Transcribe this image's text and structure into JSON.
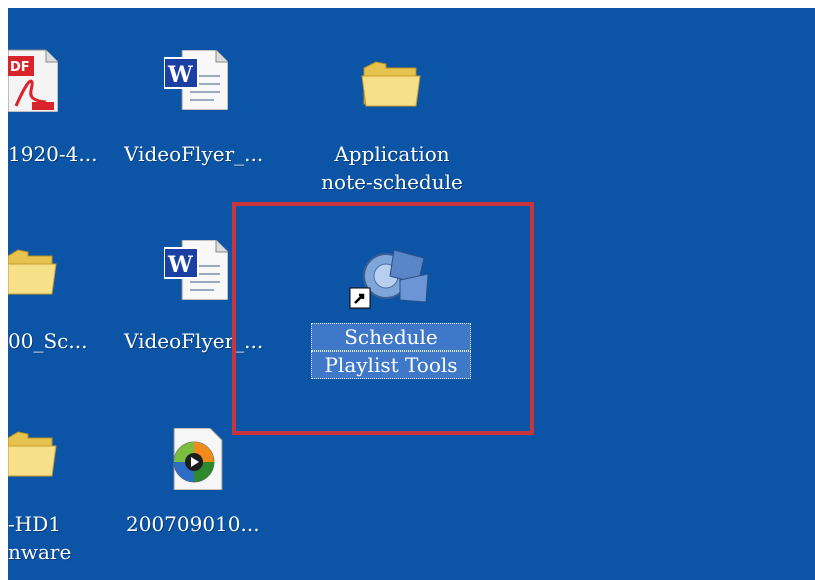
{
  "desktop": {
    "background_color": "#0b54a6",
    "highlight_color": "#c9353c",
    "icons": [
      {
        "label": "1920-4...",
        "icon": "pdf-file-icon"
      },
      {
        "label": "VideoFlyer_...",
        "icon": "word-document-icon"
      },
      {
        "label_line1": "Application",
        "label_line2": "note-schedule",
        "icon": "folder-icon"
      },
      {
        "label": "00_Sc...",
        "icon": "folder-icon"
      },
      {
        "label": "VideoFlyer_...",
        "icon": "word-document-icon"
      },
      {
        "label_line1": "Schedule",
        "label_line2": "Playlist Tools",
        "icon": "schedule-playlist-tools-shortcut-icon",
        "selected": true
      },
      {
        "label_line1": "-HD1",
        "label_line2": "nware",
        "icon": "folder-icon"
      },
      {
        "label": "200709010...",
        "icon": "media-file-icon"
      }
    ]
  }
}
